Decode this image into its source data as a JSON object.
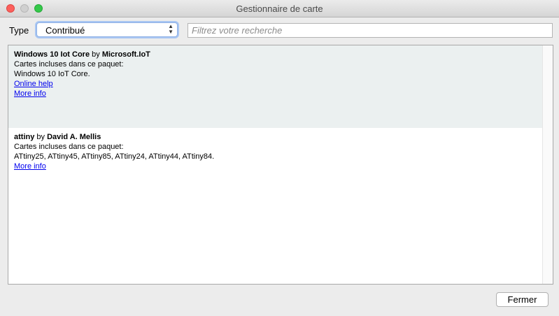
{
  "window": {
    "title": "Gestionnaire de carte"
  },
  "filter": {
    "type_label": "Type",
    "type_selected": "Contribué",
    "search_placeholder": "Filtrez votre recherche"
  },
  "packages": [
    {
      "name": "Windows 10 Iot Core",
      "by": "by",
      "author": "Microsoft.IoT",
      "boards_intro": "Cartes incluses dans ce paquet:",
      "boards": "Windows 10 IoT Core.",
      "online_help": "Online help",
      "more_info": "More info"
    },
    {
      "name": "attiny",
      "by": "by",
      "author": "David A. Mellis",
      "boards_intro": "Cartes incluses dans ce paquet:",
      "boards": "ATtiny25, ATtiny45, ATtiny85, ATtiny24, ATtiny44, ATtiny84.",
      "more_info": "More info"
    }
  ],
  "footer": {
    "close_label": "Fermer"
  }
}
